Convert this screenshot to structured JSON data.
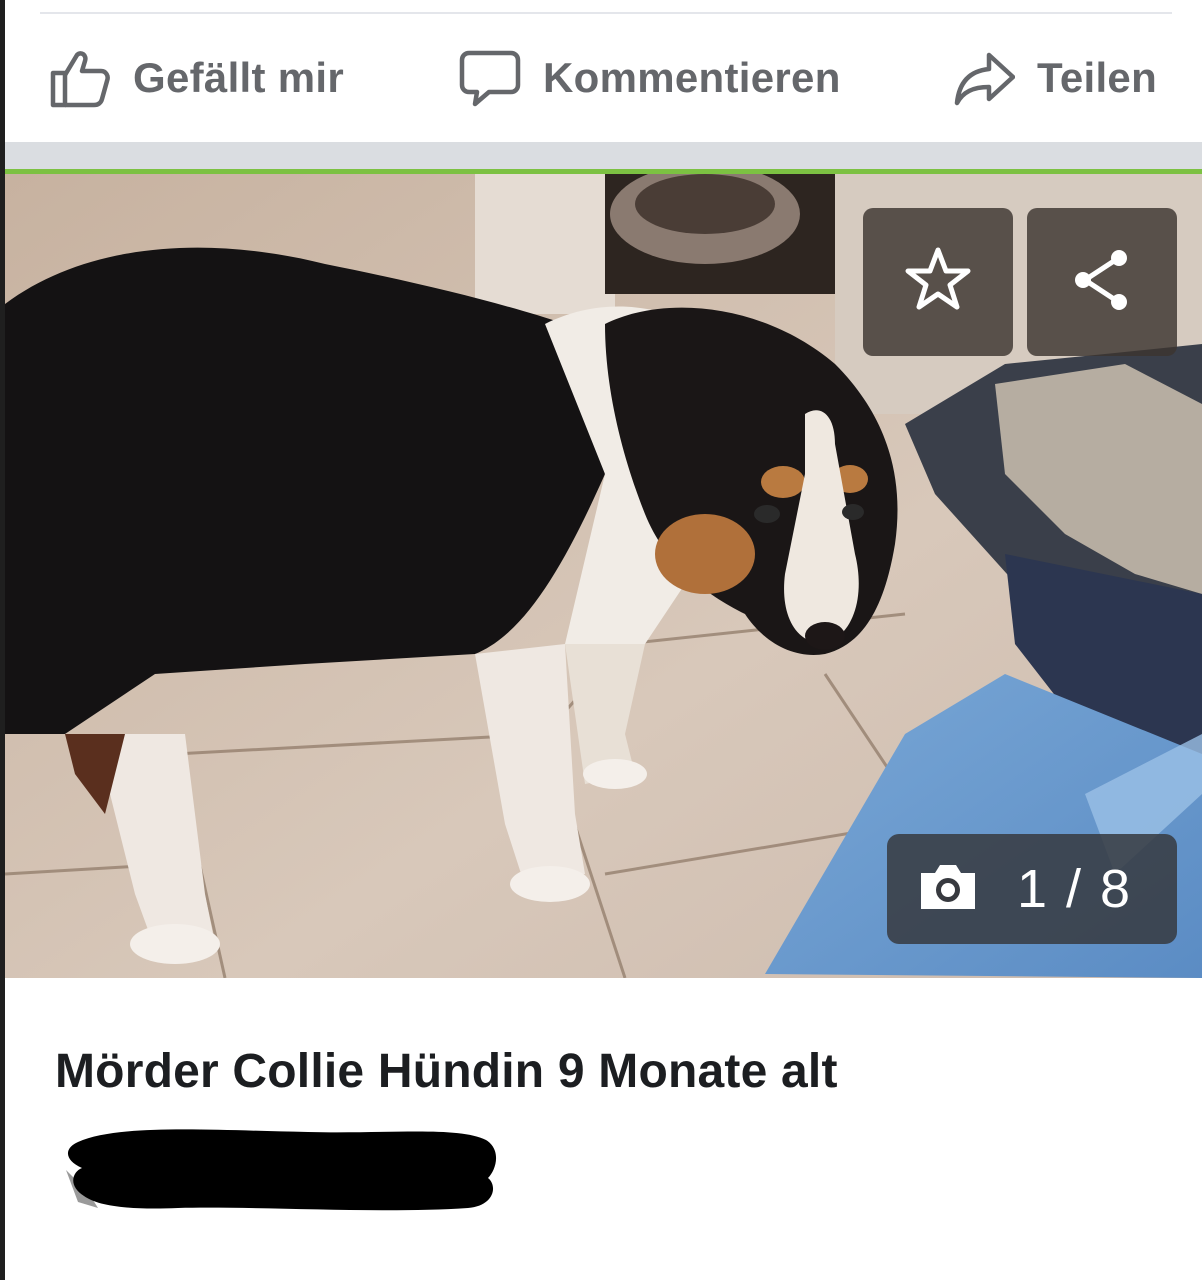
{
  "actions": {
    "like_label": "Gefällt mir",
    "comment_label": "Kommentieren",
    "share_label": "Teilen"
  },
  "photo": {
    "counter": "1 / 8"
  },
  "listing": {
    "title": "Mörder Collie Hündin 9 Monate alt"
  },
  "icons": {
    "like": "thumbs-up-icon",
    "comment": "comment-bubble-icon",
    "share": "share-arrow-icon",
    "favorite": "star-icon",
    "share_overlay": "share-nodes-icon",
    "camera": "camera-icon"
  },
  "colors": {
    "accent_green": "#7cc142",
    "action_text": "#65676b",
    "title_text": "#1c1e21"
  }
}
